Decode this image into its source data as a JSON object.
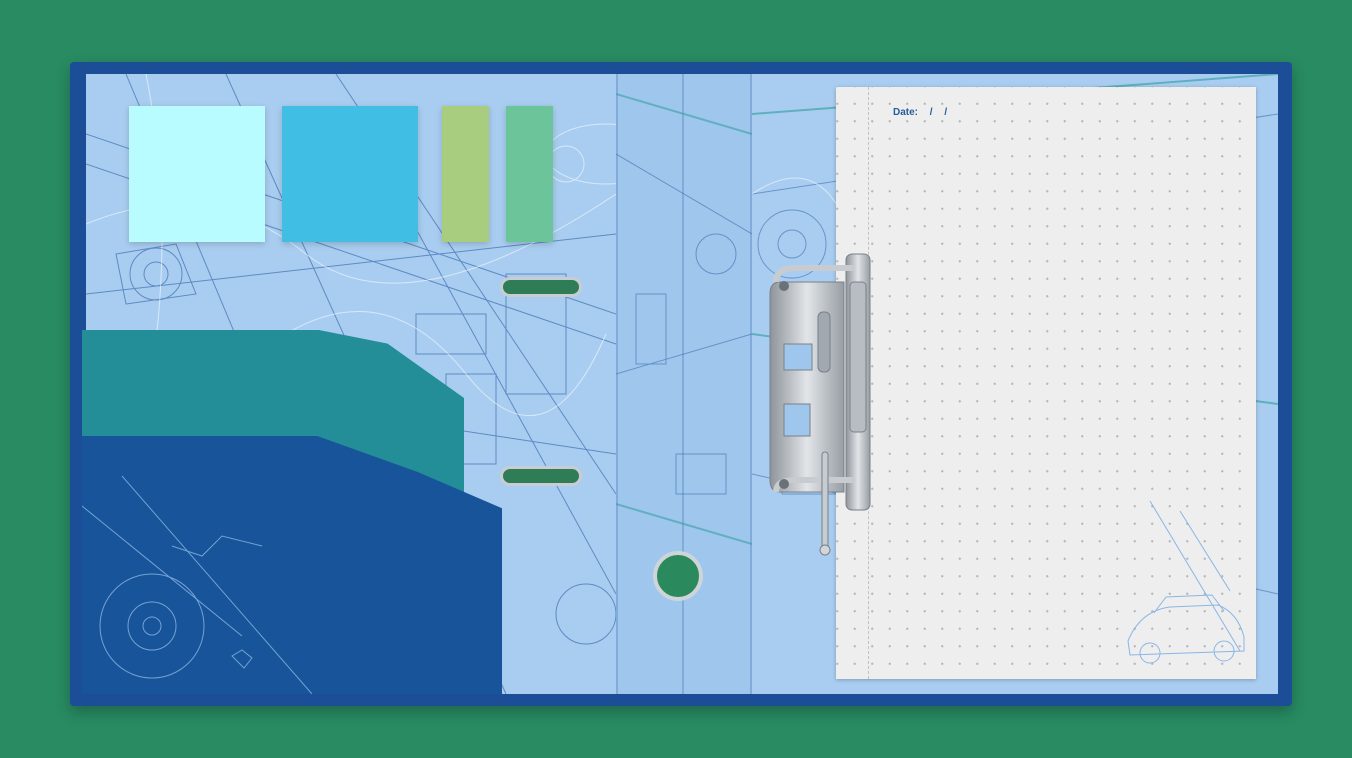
{
  "paper": {
    "date_label": "Date:",
    "date_separator_1": "/",
    "date_separator_2": "/"
  },
  "sticky_notes": [
    {
      "color": "#b8fcff"
    },
    {
      "color": "#40bee4"
    },
    {
      "color": "#a8cd7f"
    },
    {
      "color": "#6cc49b"
    }
  ],
  "colors": {
    "background": "#288b62",
    "binder_cover": "#1b4e96",
    "inner_panel": "#a9cdf0",
    "pocket_back": "#238e98",
    "pocket_front": "#17549a",
    "paper": "#eeeeee",
    "date_text": "#245c9c"
  }
}
